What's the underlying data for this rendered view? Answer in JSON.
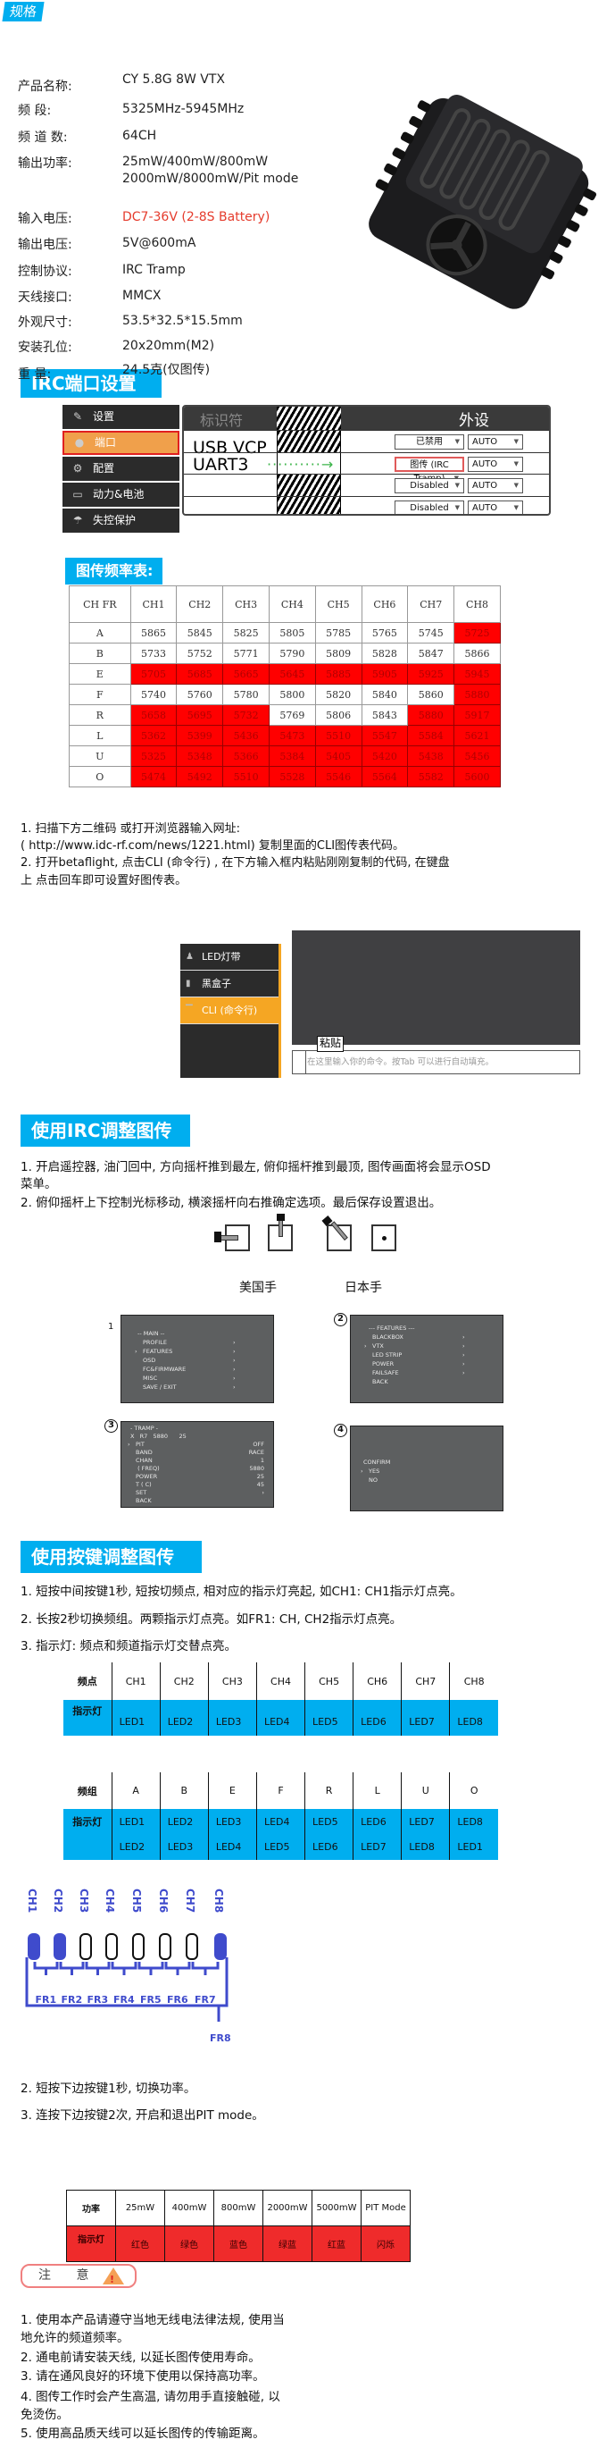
{
  "spec": {
    "tag": "规格",
    "rows": [
      {
        "label": "产品名称:",
        "value": "CY 5.8G  8W  VTX"
      },
      {
        "label": "频        段:",
        "value": "5325MHz-5945MHz"
      },
      {
        "label": "频 道 数:",
        "value": "64CH"
      },
      {
        "label": "输出功率:",
        "value": "25mW/400mW/800mW\n2000mW/8000mW/Pit mode"
      },
      {
        "label": "输入电压:",
        "value": "DC7-36V  (2-8S Battery)",
        "highlight": "#e53b2c"
      },
      {
        "label": "输出电压:",
        "value": "5V@600mA"
      },
      {
        "label": "控制协议:",
        "value": "IRC Tramp"
      },
      {
        "label": "天线接口:",
        "value": "MMCX"
      },
      {
        "label": "外观尺寸:",
        "value": "53.5*32.5*15.5mm"
      },
      {
        "label": "安装孔位:",
        "value": "20x20mm(M2)"
      },
      {
        "label": "重        量:",
        "value": "24.5克(仅图传)"
      }
    ]
  },
  "irc_port": {
    "title": "IRC端口设置",
    "sidebar": [
      {
        "label": "设置",
        "icon": "wrench-icon"
      },
      {
        "label": "端口",
        "icon": "plug-icon",
        "active": true
      },
      {
        "label": "配置",
        "icon": "gear-icon"
      },
      {
        "label": "动力&电池",
        "icon": "battery-icon"
      },
      {
        "label": "失控保护",
        "icon": "parachute-icon"
      }
    ],
    "header_identifier": "标识符",
    "header_peripheral": "外设",
    "rows": [
      {
        "name": "USB VCP",
        "peripheral": "已禁用",
        "speed": "AUTO"
      },
      {
        "name": "UART3",
        "peripheral": "图传 (IRC Tramp)",
        "speed": "AUTO",
        "highlight": true
      },
      {
        "name": "",
        "peripheral": "Disabled",
        "speed": "AUTO"
      },
      {
        "name": "",
        "peripheral": "Disabled",
        "speed": "AUTO"
      }
    ]
  },
  "freq_table": {
    "title": "图传频率表:",
    "corner": "CH FR",
    "columns": [
      "CH1",
      "CH2",
      "CH3",
      "CH4",
      "CH5",
      "CH6",
      "CH7",
      "CH8"
    ],
    "rows": [
      {
        "band": "A",
        "values": [
          5865,
          5845,
          5825,
          5805,
          5785,
          5765,
          5745,
          5725
        ],
        "red": [
          false,
          false,
          false,
          false,
          false,
          false,
          false,
          true
        ]
      },
      {
        "band": "B",
        "values": [
          5733,
          5752,
          5771,
          5790,
          5809,
          5828,
          5847,
          5866
        ],
        "red": [
          false,
          false,
          false,
          false,
          false,
          false,
          false,
          false
        ]
      },
      {
        "band": "E",
        "values": [
          5705,
          5685,
          5665,
          5645,
          5885,
          5905,
          5925,
          5945
        ],
        "red": [
          true,
          true,
          true,
          true,
          true,
          true,
          true,
          true
        ]
      },
      {
        "band": "F",
        "values": [
          5740,
          5760,
          5780,
          5800,
          5820,
          5840,
          5860,
          5880
        ],
        "red": [
          false,
          false,
          false,
          false,
          false,
          false,
          false,
          true
        ]
      },
      {
        "band": "R",
        "values": [
          5658,
          5695,
          5732,
          5769,
          5806,
          5843,
          5880,
          5917
        ],
        "red": [
          true,
          true,
          true,
          false,
          false,
          false,
          true,
          true
        ]
      },
      {
        "band": "L",
        "values": [
          5362,
          5399,
          5436,
          5473,
          5510,
          5547,
          5584,
          5621
        ],
        "red": [
          true,
          true,
          true,
          true,
          true,
          true,
          true,
          true
        ]
      },
      {
        "band": "U",
        "values": [
          5325,
          5348,
          5366,
          5384,
          5405,
          5420,
          5438,
          5456
        ],
        "red": [
          true,
          true,
          true,
          true,
          true,
          true,
          true,
          true
        ]
      },
      {
        "band": "O",
        "values": [
          5474,
          5492,
          5510,
          5528,
          5546,
          5564,
          5582,
          5600
        ],
        "red": [
          true,
          true,
          true,
          true,
          true,
          true,
          true,
          true
        ]
      }
    ]
  },
  "cli_instructions": [
    "1. 扫描下方二维码 或打开浏览器输入网址:",
    " (  http://www.idc-rf.com/news/1221.html) 复制里面的CLI图传表代码。",
    " 2. 打开betaflight, 点击CLI (命令行) , 在下方输入框内粘贴刚刚复制的代码, 在键盘",
    "上 点击回车即可设置好图传表。"
  ],
  "cli_panel": {
    "items": [
      {
        "label": "LED灯带",
        "icon": "led-strip-icon"
      },
      {
        "label": "黑盒子",
        "icon": "blackbox-icon"
      },
      {
        "label": "CLI (命令行)",
        "icon": "terminal-icon",
        "active": true
      }
    ],
    "paste_tooltip": "粘贴",
    "input_placeholder": "在这里输入你的命令。按Tab 可以进行自动填充。"
  },
  "irc_adjust": {
    "title": "使用IRC调整图传",
    "steps": [
      "1. 开启遥控器, 油门回中, 方向摇杆推到最左, 俯仰摇杆推到最顶, 图传画面将会显示OSD",
      "菜单。",
      "2. 俯仰摇杆上下控制光标移动, 横滚摇杆向右推确定选项。最后保存设置退出。"
    ],
    "mode_labels": [
      "美国手",
      "日本手"
    ],
    "osd_screens": [
      {
        "num": "1",
        "lines": [
          "-- MAIN --",
          "PROFILE",
          "FEATURES",
          "OSD",
          "FC&FIRMWARE",
          "MISC",
          "SAVE / EXIT"
        ],
        "cursor": 2
      },
      {
        "num": "2",
        "lines": [
          "--- FEATURES ---",
          "BLACKBOX",
          "VTX",
          "LED STRIP",
          "POWER",
          "FAILSAFE",
          "BACK"
        ],
        "cursor": 2
      },
      {
        "num": "3",
        "lines": [
          "- TRAMP -",
          "X   R7   5880      25",
          "PIT",
          "BAND",
          "CHAN",
          " ( FREQ)",
          "POWER",
          "T ( C)",
          "SET",
          "BACK"
        ],
        "values": [
          "",
          "",
          "OFF",
          "RACE",
          "1",
          "5880",
          "25",
          "45",
          "›",
          ""
        ],
        "cursor": 2
      },
      {
        "num": "4",
        "lines": [
          "CONFIRM",
          "YES",
          "NO"
        ],
        "cursor": 1
      }
    ]
  },
  "key_adjust": {
    "title": "使用按键调整图传",
    "steps": [
      "1. 短按中间按键1秒, 短按切频点, 相对应的指示灯亮起, 如CH1: CH1指示灯点亮。",
      "2. 长按2秒切换频组。两颗指示灯点亮。如FR1: CH, CH2指示灯点亮。",
      "3. 指示灯: 频点和频道指示灯交替点亮。"
    ],
    "channel_table": {
      "header_label": "频点",
      "header": [
        "CH1",
        "CH2",
        "CH3",
        "CH4",
        "CH5",
        "CH6",
        "CH7",
        "CH8"
      ],
      "row_label": "指示灯",
      "leds": [
        "LED1",
        "LED2",
        "LED3",
        "LED4",
        "LED5",
        "LED6",
        "LED7",
        "LED8"
      ]
    },
    "band_table": {
      "header_label": "频组",
      "header": [
        "A",
        "B",
        "E",
        "F",
        "R",
        "L",
        "U",
        "O"
      ],
      "row_label": "指示灯",
      "leds_row1": [
        "LED1",
        "LED2",
        "LED3",
        "LED4",
        "LED5",
        "LED6",
        "LED7",
        "LED8"
      ],
      "leds_row2": [
        "LED2",
        "LED3",
        "LED4",
        "LED5",
        "LED6",
        "LED7",
        "LED8",
        "LED1"
      ]
    },
    "led_diagram": {
      "channels": [
        "CH1",
        "CH2",
        "CH3",
        "CH4",
        "CH5",
        "CH6",
        "CH7",
        "CH8"
      ],
      "lit": [
        true,
        true,
        false,
        false,
        false,
        false,
        false,
        true
      ],
      "groups": [
        "FR1",
        "FR2",
        "FR3",
        "FR4",
        "FR5",
        "FR6",
        "FR7",
        "FR8"
      ],
      "color": "#3f4bcc"
    },
    "power_steps": [
      "2. 短按下边按键1秒, 切换功率。",
      "3. 连按下边按键2次, 开启和退出PIT mode。"
    ],
    "power_table": {
      "header_label": "功率",
      "header": [
        "25mW",
        "400mW",
        "800mW",
        "2000mW",
        "5000mW",
        "PIT Mode"
      ],
      "row_label": "指示灯",
      "colors": [
        "红色",
        "绿色",
        "蓝色",
        "绿蓝",
        "红蓝",
        "闪烁"
      ]
    }
  },
  "notice": {
    "title": "注 意",
    "items": [
      "1. 使用本产品请遵守当地无线电法律法规, 使用当",
      "地允许的频道频率。",
      "2. 通电前请安装天线, 以延长图传使用寿命。",
      "3. 请在通风良好的环境下使用以保持高功率。",
      "4. 图传工作时会产生高温, 请勿用手直接触碰, 以",
      "免烫伤。",
      "5. 使用高品质天线可以延长图传的传输距离。"
    ]
  },
  "colors": {
    "accent": "#00aeef",
    "warning_red": "#ff0000",
    "led_blue": "#3f4bcc"
  }
}
